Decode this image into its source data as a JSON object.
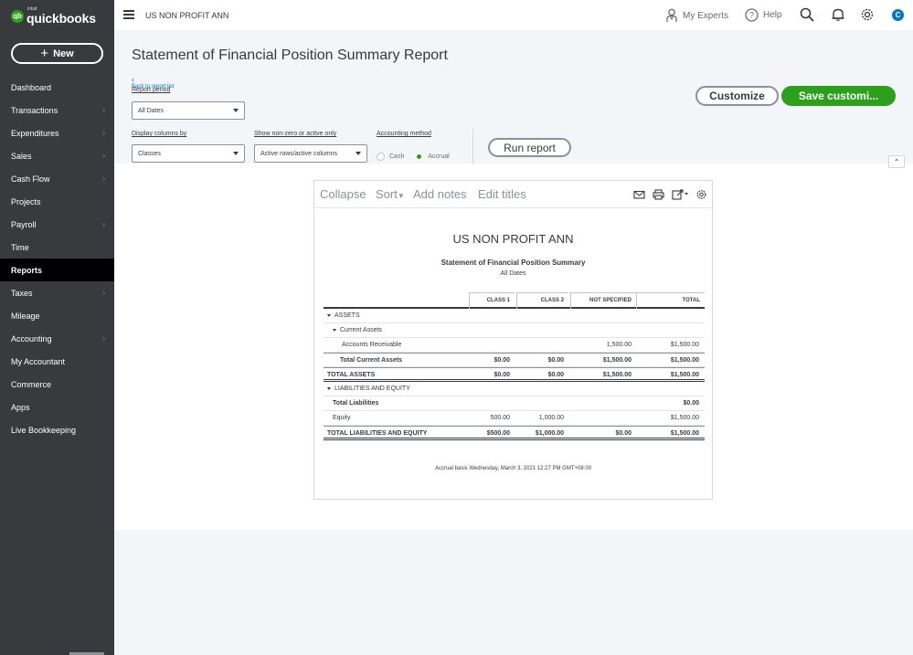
{
  "app": {
    "logo_intuit": "intuit",
    "logo_text": "quickbooks",
    "logo_mark": "qb",
    "company_name": "US NON PROFIT ANN"
  },
  "sidebar": {
    "new_label": "New",
    "items": [
      {
        "label": "Dashboard",
        "chevron": false,
        "active": false
      },
      {
        "label": "Transactions",
        "chevron": true,
        "active": false
      },
      {
        "label": "Expenditures",
        "chevron": true,
        "active": false
      },
      {
        "label": "Sales",
        "chevron": true,
        "active": false
      },
      {
        "label": "Cash Flow",
        "chevron": true,
        "active": false
      },
      {
        "label": "Projects",
        "chevron": false,
        "active": false
      },
      {
        "label": "Payroll",
        "chevron": true,
        "active": false
      },
      {
        "label": "Time",
        "chevron": false,
        "active": false
      },
      {
        "label": "Reports",
        "chevron": false,
        "active": true
      },
      {
        "label": "Taxes",
        "chevron": true,
        "active": false
      },
      {
        "label": "Mileage",
        "chevron": false,
        "active": false
      },
      {
        "label": "Accounting",
        "chevron": true,
        "active": false
      },
      {
        "label": "My Accountant",
        "chevron": false,
        "active": false
      },
      {
        "label": "Commerce",
        "chevron": false,
        "active": false
      },
      {
        "label": "Apps",
        "chevron": false,
        "active": false
      },
      {
        "label": "Live Bookkeeping",
        "chevron": false,
        "active": false
      }
    ]
  },
  "topbar": {
    "my_experts": "My Experts",
    "help": "Help",
    "avatar_initial": "C",
    "icons": [
      "menu-icon",
      "person-icon",
      "help-icon",
      "search-icon",
      "bell-icon",
      "gear-icon"
    ]
  },
  "header": {
    "page_title": "Statement of Financial Position Summary Report",
    "back_link": "Back to report list",
    "report_period_label": "Report period",
    "report_period_value": "All Dates",
    "display_columns_label": "Display columns by",
    "display_columns_value": "Classes",
    "show_nonzero_label": "Show non-zero or active only",
    "show_nonzero_value": "Active rows/active columns",
    "accounting_method_label": "Accounting method",
    "method_cash": "Cash",
    "method_accrual": "Accrual",
    "method_selected": "Accrual",
    "run_report": "Run report",
    "customize": "Customize",
    "save_customization": "Save customi..."
  },
  "report": {
    "toolbar": {
      "collapse": "Collapse",
      "sort": "Sort",
      "add_notes": "Add notes",
      "edit_titles": "Edit titles"
    },
    "company": "US NON PROFIT ANN",
    "title": "Statement of Financial Position Summary",
    "dates": "All Dates",
    "columns": [
      "CLASS 1",
      "CLASS 2",
      "NOT SPECIFIED",
      "TOTAL"
    ],
    "rows": [
      {
        "label": "ASSETS",
        "indent": 0,
        "toggle": true,
        "values": [
          "",
          "",
          "",
          ""
        ],
        "bold": false,
        "line": false
      },
      {
        "label": "Current Assets",
        "indent": 1,
        "toggle": true,
        "values": [
          "",
          "",
          "",
          ""
        ],
        "bold": false,
        "line": false
      },
      {
        "label": "Accounts Receivable",
        "indent": 3,
        "toggle": false,
        "values": [
          "",
          "",
          "1,500.00",
          "$1,500.00"
        ],
        "bold": false,
        "line": false
      },
      {
        "label": "Total Current Assets",
        "indent": 2,
        "toggle": false,
        "values": [
          "$0.00",
          "$0.00",
          "$1,500.00",
          "$1,500.00"
        ],
        "bold": true,
        "line": true
      },
      {
        "label": "TOTAL ASSETS",
        "indent": 0,
        "toggle": false,
        "values": [
          "$0.00",
          "$0.00",
          "$1,500.00",
          "$1,500.00"
        ],
        "bold": true,
        "line": true
      },
      {
        "label": "LIABILITIES AND EQUITY",
        "indent": 0,
        "toggle": true,
        "values": [
          "",
          "",
          "",
          ""
        ],
        "bold": false,
        "line": false
      },
      {
        "label": "Total Liabilities",
        "indent": 1,
        "toggle": false,
        "values": [
          "",
          "",
          "",
          "$0.00"
        ],
        "bold": true,
        "line": false
      },
      {
        "label": "Equity",
        "indent": 1,
        "toggle": false,
        "values": [
          "500.00",
          "1,000.00",
          "",
          "$1,500.00"
        ],
        "bold": false,
        "line": false
      },
      {
        "label": "TOTAL LIABILITIES AND EQUITY",
        "indent": 0,
        "toggle": false,
        "values": [
          "$500.00",
          "$1,000.00",
          "$0.00",
          "$1,500.00"
        ],
        "bold": true,
        "line": true
      }
    ],
    "footer": "Accrual basis  Wednesday, March 3, 2021   12:27 PM GMT+08:00"
  },
  "colors": {
    "sidebar_bg": "#393a3d",
    "accent_green": "#2ca01c",
    "link_blue": "#0077c5",
    "header_bg": "#f4f5f8"
  }
}
